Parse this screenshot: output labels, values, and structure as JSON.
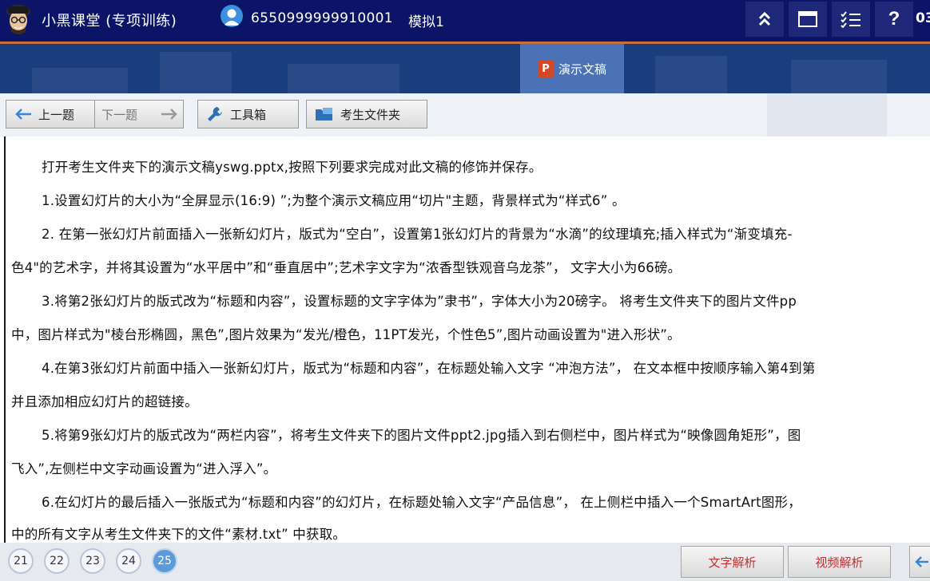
{
  "header": {
    "app_title": "小黑课堂 (专项训练)",
    "user_id": "6550999999910001",
    "mode": "模拟1",
    "clipped_text": "03"
  },
  "banner": {
    "active_tab": "演示文稿",
    "ppt_letter": "P"
  },
  "toolbar": {
    "prev_label": "上一题",
    "next_label": "下一题",
    "tools_label": "工具箱",
    "folder_label": "考生文件夹"
  },
  "content": {
    "lines": [
      "打开考生文件夹下的演示文稿yswg.pptx,按照下列要求完成对此文稿的修饰并保存。",
      "1.设置幻灯片的大小为“全屏显示(16:9) ”;为整个演示文稿应用“切片\"主题，背景样式为“样式6” 。",
      "2. 在第一张幻灯片前面插入一张新幻灯片，版式为“空白”，设置第1张幻灯片的背景为“水滴”的纹理填充;插入样式为“渐变填充-",
      "色4\"的艺术字，并将其设置为“水平居中”和“垂直居中”;艺术字文字为“浓香型铁观音乌龙茶”， 文字大小为66磅。",
      "3.将第2张幻灯片的版式改为“标题和内容”，设置标题的文字字体为”隶书”，字体大小为20磅字。 将考生文件夹下的图片文件pp",
      "中，图片样式为\"棱台形椭圆，黑色”,图片效果为“发光/橙色，11PT发光，个性色5”,图片动画设置为\"进入形状”。",
      "4.在第3张幻灯片前面中插入一张新幻灯片，版式为“标题和内容”，在标题处输入文字 “冲泡方法”， 在文本框中按顺序输入第4到第",
      "并且添加相应幻灯片的超链接。",
      "5.将第9张幻灯片的版式改为“两栏内容”，将考生文件夹下的图片文件ppt2.jpg插入到右侧栏中，图片样式为“映像圆角矩形”，图",
      "飞入”,左侧栏中文字动画设置为“进入浮入”。",
      "6.在幻灯片的最后插入一张版式为“标题和内容”的幻灯片，在标题处输入文字“产品信息”， 在上侧栏中插入一个SmartArt图形，",
      "中的所有文字从考生文件夹下的文件“素材.txt” 中获取。"
    ]
  },
  "bottom": {
    "questions": [
      "21",
      "22",
      "23",
      "24",
      "25"
    ],
    "current_question": "25",
    "text_analysis_label": "文字解析",
    "video_analysis_label": "视频解析"
  },
  "colors": {
    "header_bg": "#0b1466",
    "banner_bg": "#1a3d7e",
    "active_tab": "#4b72b6",
    "accent_line": "#c8703c",
    "analysis_text": "#c03030"
  },
  "icons": [
    "avatar-logo-icon",
    "user-icon",
    "collapse-icon",
    "window-icon",
    "checklist-icon",
    "help-icon",
    "ppt-icon",
    "arrow-left-icon",
    "arrow-right-icon",
    "wrench-icon",
    "folder-icon"
  ]
}
